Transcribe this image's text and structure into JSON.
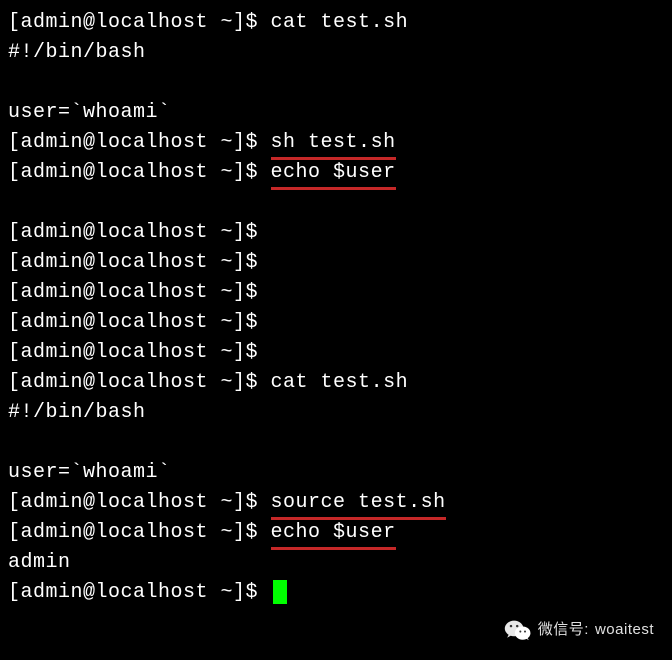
{
  "prompt": "[admin@localhost ~]$ ",
  "lines": [
    {
      "type": "cmd",
      "command": "cat test.sh",
      "underline": false
    },
    {
      "type": "out",
      "text": "#!/bin/bash"
    },
    {
      "type": "blank"
    },
    {
      "type": "out",
      "text": "user=`whoami`"
    },
    {
      "type": "cmd",
      "command": "sh test.sh",
      "underline": true
    },
    {
      "type": "cmd",
      "command": "echo $user",
      "underline": true
    },
    {
      "type": "blank"
    },
    {
      "type": "cmd",
      "command": "",
      "underline": false
    },
    {
      "type": "cmd",
      "command": "",
      "underline": false
    },
    {
      "type": "cmd",
      "command": "",
      "underline": false
    },
    {
      "type": "cmd",
      "command": "",
      "underline": false
    },
    {
      "type": "cmd",
      "command": "",
      "underline": false
    },
    {
      "type": "cmd",
      "command": "cat test.sh",
      "underline": false
    },
    {
      "type": "out",
      "text": "#!/bin/bash"
    },
    {
      "type": "blank"
    },
    {
      "type": "out",
      "text": "user=`whoami`"
    },
    {
      "type": "cmd",
      "command": "source test.sh",
      "underline": true
    },
    {
      "type": "cmd",
      "command": "echo $user",
      "underline": true
    },
    {
      "type": "out",
      "text": "admin"
    },
    {
      "type": "prompt_cursor"
    }
  ],
  "watermark": {
    "label": "微信号:",
    "id": "woaitest"
  }
}
